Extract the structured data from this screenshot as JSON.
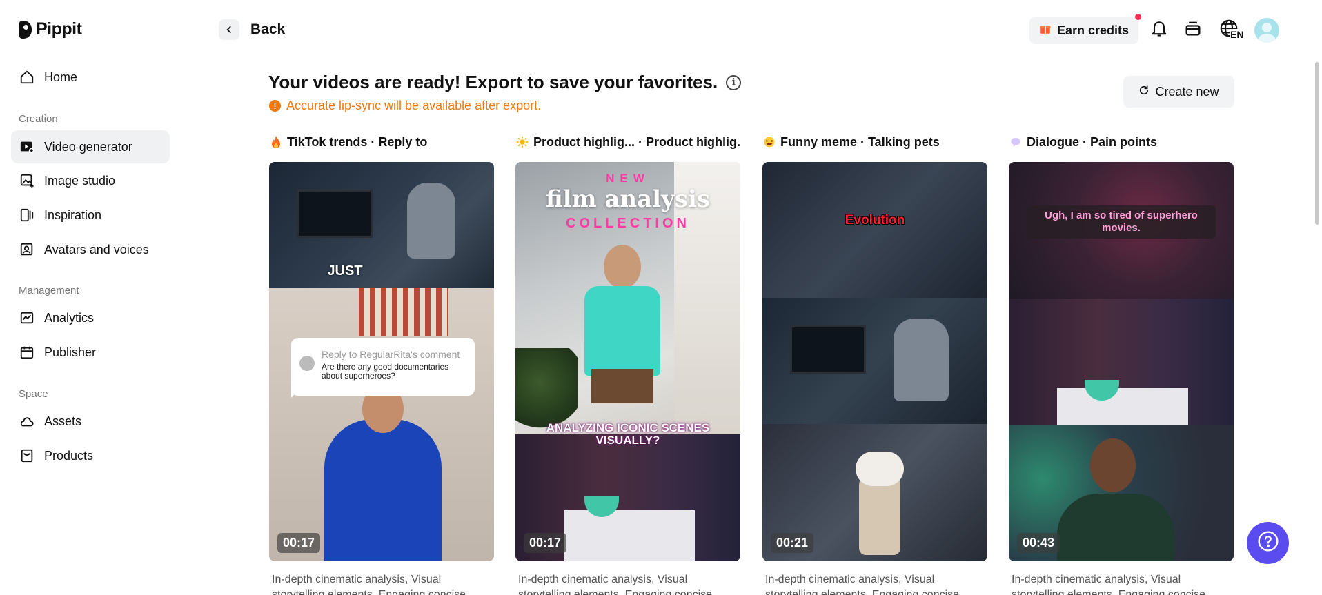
{
  "brand": {
    "name": "Pippit"
  },
  "sidebar": {
    "items": [
      {
        "label": "Home",
        "icon": "home-icon"
      },
      {
        "section": "Creation"
      },
      {
        "label": "Video generator",
        "icon": "video-generator-icon",
        "active": true
      },
      {
        "label": "Image studio",
        "icon": "image-studio-icon"
      },
      {
        "label": "Inspiration",
        "icon": "inspiration-icon"
      },
      {
        "label": "Avatars and voices",
        "icon": "avatar-icon"
      },
      {
        "section": "Management"
      },
      {
        "label": "Analytics",
        "icon": "analytics-icon"
      },
      {
        "label": "Publisher",
        "icon": "calendar-icon"
      },
      {
        "section": "Space"
      },
      {
        "label": "Assets",
        "icon": "cloud-icon"
      },
      {
        "label": "Products",
        "icon": "products-icon"
      }
    ]
  },
  "header": {
    "back_label": "Back",
    "earn_credits_label": "Earn credits",
    "language": "EN"
  },
  "main": {
    "headline": "Your videos are ready! Export to save your favorites.",
    "notice": "Accurate lip-sync will be available after export.",
    "create_new_label": "Create new"
  },
  "cards": [
    {
      "title": "TikTok trends · Reply to",
      "emoji": "fire-icon",
      "duration": "00:17",
      "overlay_text": "JUST",
      "reply_header": "Reply to RegularRita's comment",
      "reply_question": "Are there any good documentaries about superheroes?",
      "description": "In-depth cinematic analysis, Visual storytelling elements, Engaging concise"
    },
    {
      "title": "Product highlig... · Product highlig...",
      "emoji": "sun-icon",
      "duration": "00:17",
      "overlay_new": "NEW",
      "overlay_main": "film analysis",
      "overlay_collection": "COLLECTION",
      "overlay_bottom": "ANALYZING ICONIC SCENES VISUALLY?",
      "description": "In-depth cinematic analysis, Visual storytelling elements, Engaging concise"
    },
    {
      "title": "Funny meme · Talking pets",
      "emoji": "laughing-face-icon",
      "duration": "00:21",
      "overlay_text": "Evolution",
      "description": "In-depth cinematic analysis, Visual storytelling elements, Engaging concise"
    },
    {
      "title": "Dialogue · Pain points",
      "emoji": "speech-bubble-icon",
      "duration": "00:43",
      "overlay_text": "Ugh, I am so tired of superhero movies.",
      "description": "In-depth cinematic analysis, Visual storytelling elements, Engaging concise"
    }
  ],
  "colors": {
    "accent": "#5b4cf0",
    "warning": "#f07a10",
    "active_bg": "#f0f1f3",
    "notification_dot": "#ff2d55"
  }
}
